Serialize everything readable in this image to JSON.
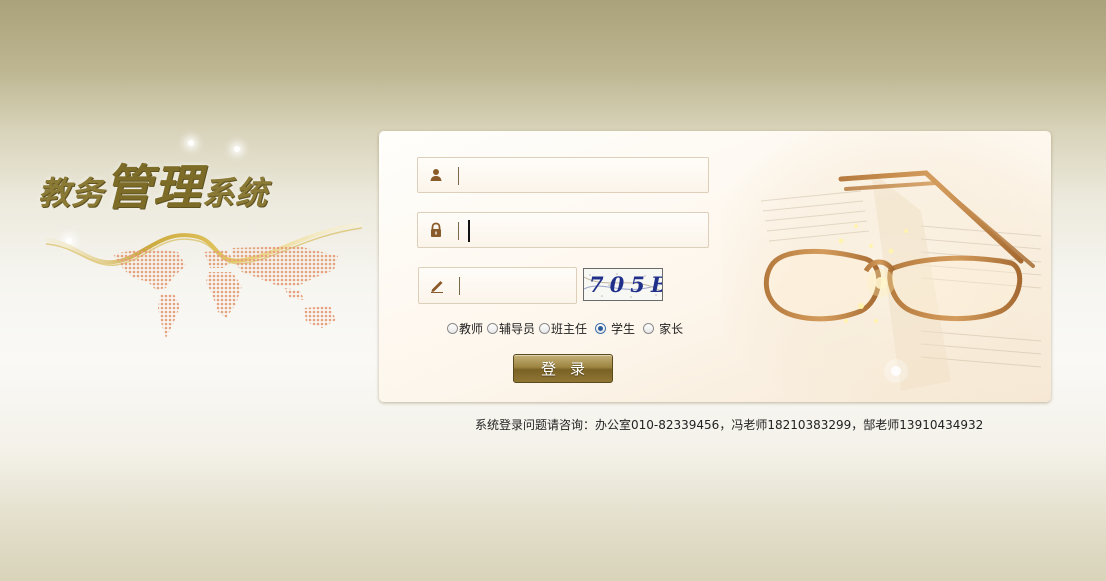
{
  "brand": {
    "title_part1": "教务",
    "title_part2": "管理",
    "title_part3": "系统"
  },
  "login": {
    "username_value": "",
    "password_value": "",
    "captcha_input_value": "",
    "captcha_text": "705B",
    "roles": [
      {
        "label": "教师",
        "checked": false
      },
      {
        "label": "辅导员",
        "checked": false
      },
      {
        "label": "班主任",
        "checked": false
      },
      {
        "label": "学生",
        "checked": true
      },
      {
        "label": "家长",
        "checked": false
      }
    ],
    "submit_label": "登录"
  },
  "footer": {
    "contact_text": "系统登录问题请咨询：办公室010-82339456，冯老师18210383299，郜老师13910434932"
  },
  "colors": {
    "accent_gold": "#8a7a35",
    "button_gold": "#9c8340",
    "icon_brown": "#8b5a2b"
  },
  "icons": {
    "username": "user-icon",
    "password": "lock-icon",
    "captcha": "pencil-icon"
  }
}
